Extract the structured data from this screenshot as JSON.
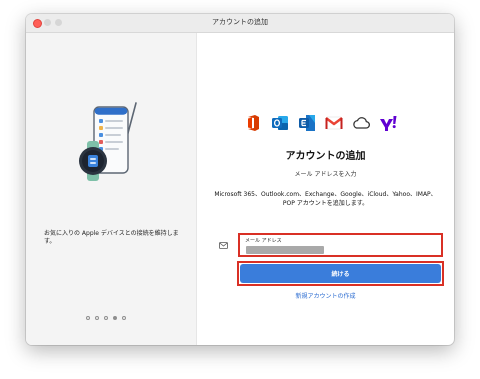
{
  "window": {
    "title": "アカウントの追加"
  },
  "left": {
    "caption": "お気に入りの Apple デバイスとの接続を維持します。",
    "pagination": {
      "count": 5,
      "active_index": 3
    }
  },
  "right": {
    "providers": [
      "office-icon",
      "outlook-icon",
      "exchange-icon",
      "gmail-icon",
      "icloud-icon",
      "yahoo-icon"
    ],
    "heading": "アカウントの追加",
    "subheading": "メール アドレスを入力",
    "description": "Microsoft 365、Outlook.com、Exchange、Google、iCloud、Yahoo、IMAP、POP アカウントを追加します。",
    "email": {
      "label": "メール アドレス",
      "value": ""
    },
    "continue_label": "続ける",
    "create_link": "新規アカウントの作成"
  },
  "colors": {
    "accent": "#3a7ddb",
    "highlight": "#d93025",
    "link": "#2a6bd1"
  }
}
